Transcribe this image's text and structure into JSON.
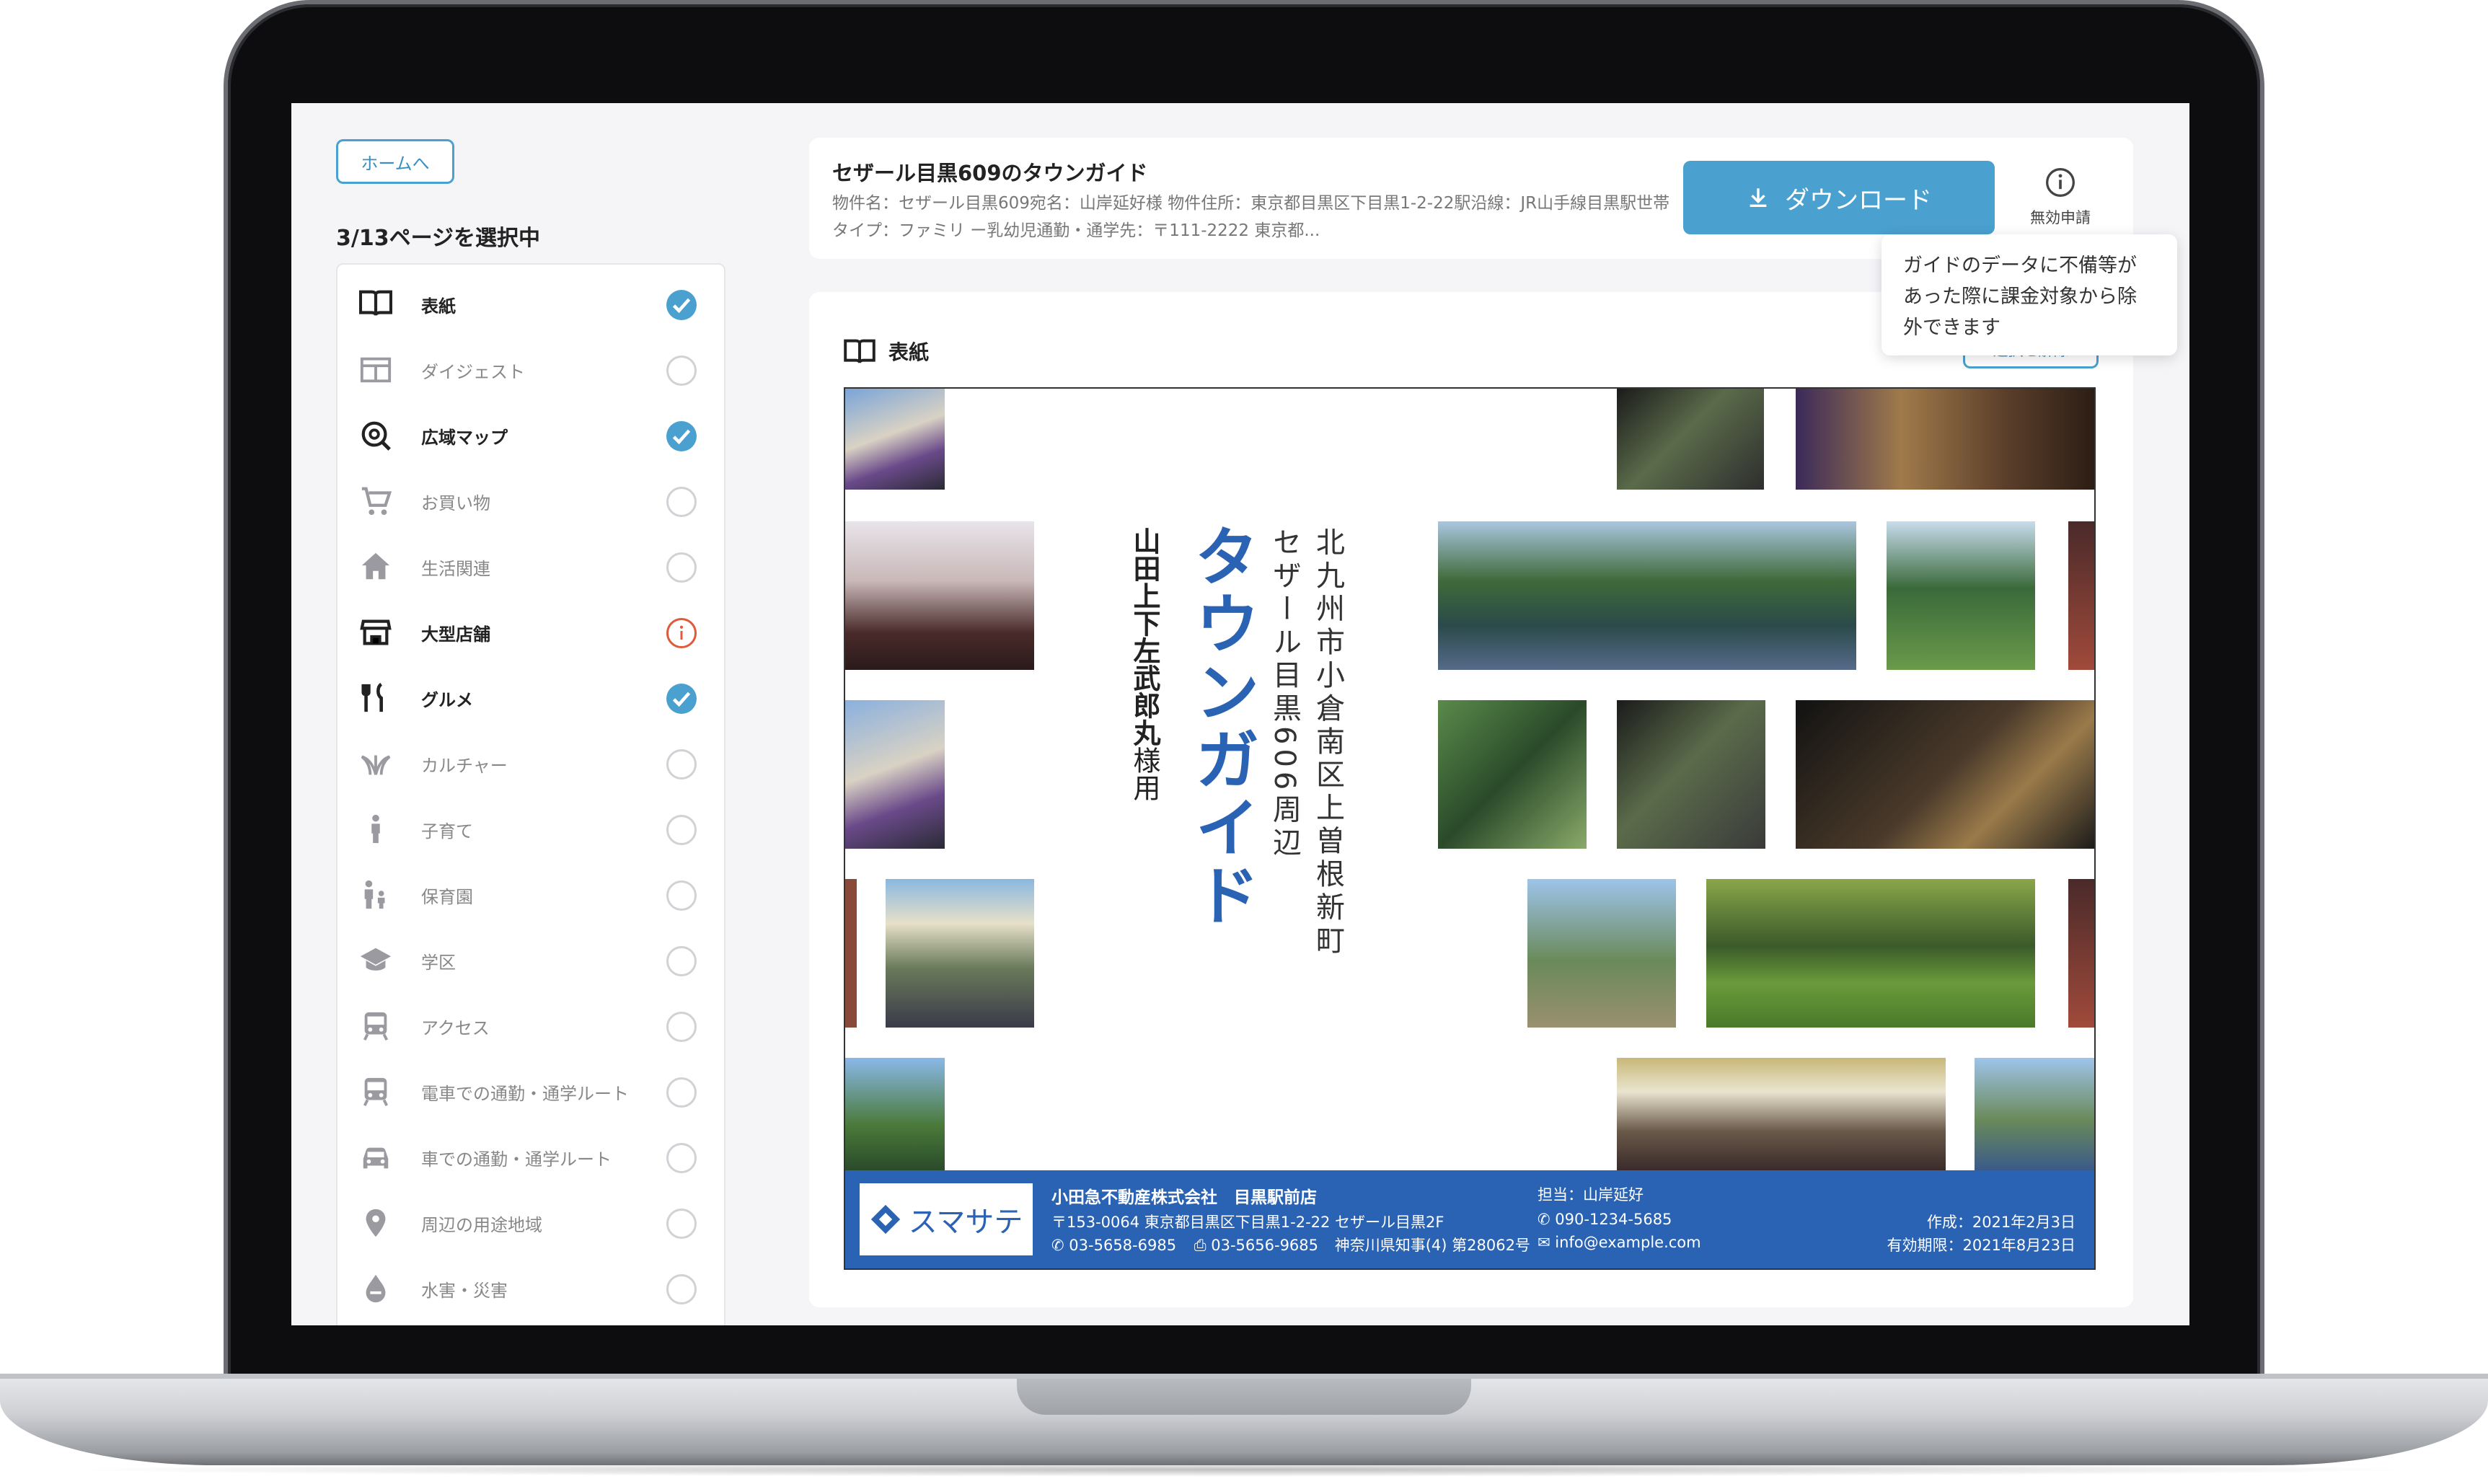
{
  "sidebar": {
    "home_label": "ホームへ",
    "selection_count": "3/13ページを選択中",
    "items": [
      {
        "label": "表紙",
        "state": "checked",
        "icon": "book-icon"
      },
      {
        "label": "ダイジェスト",
        "state": "empty",
        "icon": "layout-icon"
      },
      {
        "label": "広域マップ",
        "state": "checked",
        "icon": "map-search-icon"
      },
      {
        "label": "お買い物",
        "state": "empty",
        "icon": "cart-icon"
      },
      {
        "label": "生活関連",
        "state": "empty",
        "icon": "home-icon"
      },
      {
        "label": "大型店舗",
        "state": "warning",
        "icon": "store-icon"
      },
      {
        "label": "グルメ",
        "state": "checked",
        "icon": "restaurant-icon"
      },
      {
        "label": "カルチャー",
        "state": "empty",
        "icon": "culture-icon"
      },
      {
        "label": "子育て",
        "state": "empty",
        "icon": "child-icon"
      },
      {
        "label": "保育園",
        "state": "empty",
        "icon": "family-icon"
      },
      {
        "label": "学区",
        "state": "empty",
        "icon": "school-icon"
      },
      {
        "label": "アクセス",
        "state": "empty",
        "icon": "train-icon"
      },
      {
        "label": "電車での通勤・通学ルート",
        "state": "empty",
        "icon": "train-icon"
      },
      {
        "label": "車での通勤・通学ルート",
        "state": "empty",
        "icon": "car-icon"
      },
      {
        "label": "周辺の用途地域",
        "state": "empty",
        "icon": "pin-icon"
      },
      {
        "label": "水害・災害",
        "state": "empty",
        "icon": "drop-icon"
      }
    ]
  },
  "header": {
    "title": "セザール目黒609のタウンガイド",
    "subtitle": "物件名：セザール目黒609宛名：山岸延好様 物件住所：東京都目黒区下目黒1-2-22駅沿線：JR山手線目黒駅世帯タイプ：ファミリ ー乳幼児通勤・通学先：〒111-2222 東京都...",
    "download_label": "ダウンロード",
    "invalid_label": "無効申請",
    "tooltip": "ガイドのデータに不備等があった際に課金対象から除外できます"
  },
  "preview": {
    "label": "表紙",
    "deselect_label": "選択を解除",
    "doc": {
      "location_line1": "北九州市小倉南区上曽根新町",
      "location_line2": "セザール目黒606周辺",
      "main_title": "タウンガイド",
      "addressee": "山田上下左武郎丸",
      "addressee_suffix": "様用",
      "logo_text": "スマサテ",
      "company": "小田急不動産株式会社　目黒駅前店",
      "address": "〒153-0064 東京都目黒区下目黒1-2-22 セザール目黒2F",
      "tel": "03-5658-6985",
      "fax": "03-5656-9685",
      "license": "神奈川県知事(4) 第28062号",
      "staff": "担当：山岸延好",
      "mobile": "090-1234-5685",
      "email": "info@example.com",
      "created": "作成：2021年2月3日",
      "expires": "有効期限：2021年8月23日"
    }
  },
  "colors": {
    "accent": "#4aa0cf",
    "warning": "#e05a3c",
    "doc_blue": "#2b63b4"
  }
}
